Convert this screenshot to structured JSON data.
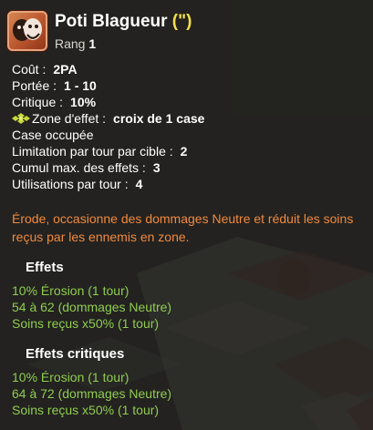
{
  "spell": {
    "name": "Poti Blagueur",
    "quote": "(\")",
    "rank_label": "Rang",
    "rank_value": "1",
    "icon": "grinning-mask-icon"
  },
  "stats": {
    "cost_label": "Coût :",
    "cost_value": "2PA",
    "range_label": "Portée :",
    "range_value": "1 - 10",
    "crit_label": "Critique :",
    "crit_value": "10%",
    "zone_label": "Zone d'effet :",
    "zone_value": "croix de 1 case",
    "occupied": "Case occupée",
    "per_target_label": "Limitation par tour par cible :",
    "per_target_value": "2",
    "cumul_label": "Cumul max. des effets :",
    "cumul_value": "3",
    "uses_label": "Utilisations par tour :",
    "uses_value": "4"
  },
  "description": "Érode, occasionne des dommages Neutre et réduit les soins reçus par les ennemis en zone.",
  "effects": {
    "title": "Effets",
    "lines": [
      "10% Érosion (1 tour)",
      "54 à 62 (dommages Neutre)",
      "Soins reçus x50% (1 tour)"
    ]
  },
  "critical_effects": {
    "title": "Effets critiques",
    "lines": [
      "10% Érosion (1 tour)",
      "64 à 72 (dommages Neutre)",
      "Soins reçus x50% (1 tour)"
    ]
  },
  "colors": {
    "accent_orange": "#f08a3e",
    "effect_green": "#8fcd4f",
    "quote_yellow": "#f3e04a"
  }
}
